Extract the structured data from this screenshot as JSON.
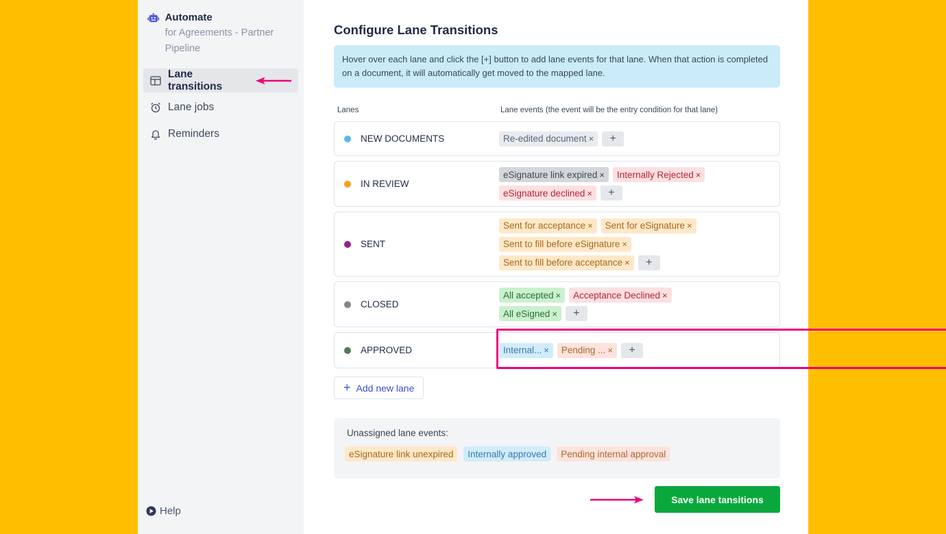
{
  "sidebar": {
    "brand_title": "Automate",
    "brand_subtitle": "for Agreements - Partner Pipeline",
    "items": [
      {
        "label": "Lane transitions",
        "icon": "layout-icon",
        "active": true
      },
      {
        "label": "Lane jobs",
        "icon": "alarm-clock-icon",
        "active": false
      },
      {
        "label": "Reminders",
        "icon": "bell-icon",
        "active": false
      }
    ],
    "help_label": "Help"
  },
  "main": {
    "title": "Configure Lane Transitions",
    "info": "Hover over each lane and click the [+] button to add lane events for that lane. When that action is completed on a document, it will automatically get moved to the mapped lane.",
    "col_lanes": "Lanes",
    "col_events": "Lane events (the event will be the entry condition for that lane)",
    "lanes": [
      {
        "name": "NEW DOCUMENTS",
        "color": "#5db7f0",
        "events": [
          {
            "label": "Re-edited document",
            "style": "gray"
          }
        ]
      },
      {
        "name": "IN REVIEW",
        "color": "#f59f1f",
        "events": [
          {
            "label": "eSignature link expired",
            "style": "darkgray"
          },
          {
            "label": "Internally Rejected",
            "style": "red"
          },
          {
            "label": "eSignature declined",
            "style": "red"
          }
        ]
      },
      {
        "name": "SENT",
        "color": "#9a1f8a",
        "events": [
          {
            "label": "Sent for acceptance",
            "style": "orange"
          },
          {
            "label": "Sent for eSignature",
            "style": "orange"
          },
          {
            "label": "Sent to fill before eSignature",
            "style": "orange"
          },
          {
            "label": "Sent to fill before acceptance",
            "style": "orange"
          }
        ]
      },
      {
        "name": "CLOSED",
        "color": "#858585",
        "events": [
          {
            "label": "All accepted",
            "style": "green"
          },
          {
            "label": "Acceptance Declined",
            "style": "red"
          },
          {
            "label": "All eSigned",
            "style": "green"
          }
        ]
      },
      {
        "name": "APPROVED",
        "color": "#4f7a53",
        "events": [
          {
            "label": "Internal...",
            "style": "blue"
          },
          {
            "label": "Pending ...",
            "style": "salmon"
          }
        ]
      }
    ],
    "add_lane_label": "Add new lane",
    "unassigned_label": "Unassigned lane events:",
    "unassigned": [
      {
        "label": "eSignature link unexpired",
        "style": "orange"
      },
      {
        "label": "Internally approved",
        "style": "blue"
      },
      {
        "label": "Pending internal approval",
        "style": "salmon"
      }
    ],
    "save_label": "Save lane tansitions",
    "remove_glyph": "×",
    "add_glyph": "+"
  },
  "colors": {
    "background": "#FFBF00",
    "highlight": "#f2007c",
    "save_button": "#0aa83c",
    "accent": "#3b4fd4"
  }
}
